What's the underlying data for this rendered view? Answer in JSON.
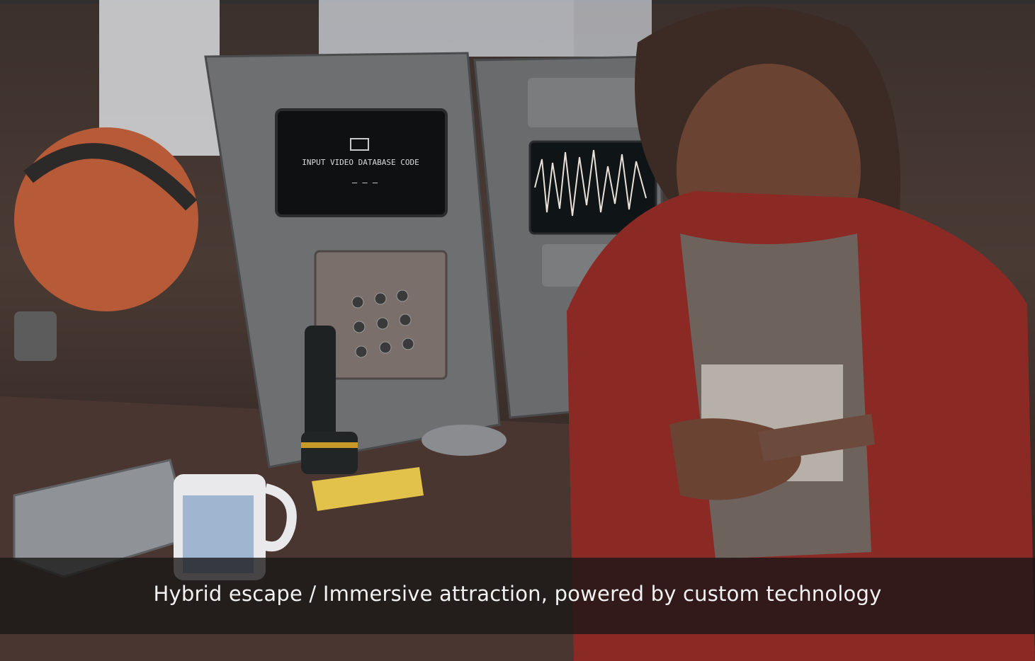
{
  "caption": "Hybrid escape / Immersive attraction, powered by custom technology",
  "terminal": {
    "prompt": "INPUT VIDEO DATABASE CODE",
    "code_placeholder": "— — —"
  },
  "colors": {
    "jacket": "#8b2a25",
    "wall": "#4a3a34",
    "panel": "#6f6f70",
    "screen": "#0e1012",
    "caption_text": "#f2f2f2"
  }
}
